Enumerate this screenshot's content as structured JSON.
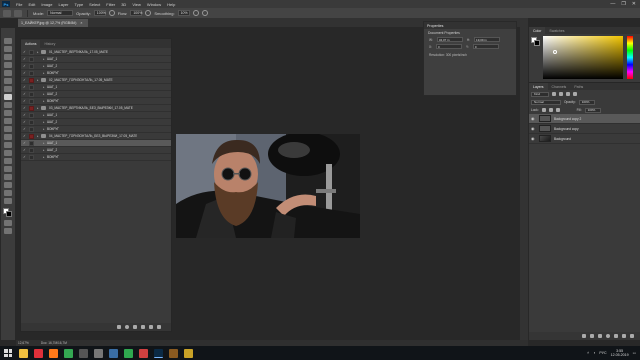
{
  "app": {
    "logo": "Ps"
  },
  "menu": [
    "File",
    "Edit",
    "Image",
    "Layer",
    "Type",
    "Select",
    "Filter",
    "3D",
    "View",
    "Window",
    "Help"
  ],
  "window_controls": [
    "—",
    "❐",
    "✕"
  ],
  "options_bar": {
    "mode_label": "Mode:",
    "mode_value": "Normal",
    "opacity_label": "Opacity:",
    "opacity_value": "100%",
    "flow_label": "Flow:",
    "flow_value": "100%",
    "smoothing_label": "Smoothing:",
    "smoothing_value": "10%"
  },
  "document_tab": {
    "title": "1_ЕАЙКЕР.jpg @ 12,7% (RGB/8#)",
    "close": "×"
  },
  "actions_panel": {
    "tabs": [
      "Actions",
      "History"
    ],
    "rows": [
      {
        "check": "✓",
        "dialog": "dark",
        "indent": 0,
        "folder": true,
        "name": "01_МАСТЕР_ВЕРТИКАЛЬ_17.05_МАТЕ",
        "selected": false
      },
      {
        "check": "✓",
        "dialog": "dark",
        "indent": 1,
        "folder": false,
        "name": "ШАГ_1",
        "selected": false
      },
      {
        "check": "✓",
        "dialog": "dark",
        "indent": 1,
        "folder": false,
        "name": "ШАГ_2",
        "selected": false
      },
      {
        "check": "✓",
        "dialog": "dark",
        "indent": 1,
        "folder": false,
        "name": "ВОКРУГ",
        "selected": false
      },
      {
        "check": "✓",
        "dialog": "red",
        "indent": 0,
        "folder": true,
        "name": "02_МАСТЕР_ГОРИЗОНТАЛЬ_17.05_МАТЕ",
        "selected": false
      },
      {
        "check": "✓",
        "dialog": "dark",
        "indent": 1,
        "folder": false,
        "name": "ШАГ_1",
        "selected": false
      },
      {
        "check": "✓",
        "dialog": "dark",
        "indent": 1,
        "folder": false,
        "name": "ШАГ_2",
        "selected": false
      },
      {
        "check": "✓",
        "dialog": "dark",
        "indent": 1,
        "folder": false,
        "name": "ВОКРУГ",
        "selected": false
      },
      {
        "check": "✓",
        "dialog": "red",
        "indent": 0,
        "folder": true,
        "name": "03_МАСТЕР_ВЕРТИКАЛЬ_БЕЗ_ВЫРЕЗКИ_17.05_МАТЕ",
        "selected": false
      },
      {
        "check": "✓",
        "dialog": "dark",
        "indent": 1,
        "folder": false,
        "name": "ШАГ_1",
        "selected": false
      },
      {
        "check": "✓",
        "dialog": "dark",
        "indent": 1,
        "folder": false,
        "name": "ШАГ_2",
        "selected": false
      },
      {
        "check": "✓",
        "dialog": "dark",
        "indent": 1,
        "folder": false,
        "name": "ВОКРУГ",
        "selected": false
      },
      {
        "check": "✓",
        "dialog": "red",
        "indent": 0,
        "folder": true,
        "name": "04_МАСТЕР_ГОРИЗОНТАЛЬ_БЕЗ_ВЫРЕЗКИ_17.05_МАТЕ",
        "selected": false
      },
      {
        "check": "✓",
        "dialog": "dark",
        "indent": 1,
        "folder": false,
        "name": "ШАГ_1",
        "selected": true
      },
      {
        "check": "✓",
        "dialog": "dark",
        "indent": 1,
        "folder": false,
        "name": "ШАГ_2",
        "selected": false
      },
      {
        "check": "✓",
        "dialog": "dark",
        "indent": 1,
        "folder": false,
        "name": "ВОКРУГ",
        "selected": false
      }
    ]
  },
  "properties_panel": {
    "title": "Properties",
    "subtitle": "Document Properties",
    "w_label": "W:",
    "w_value": "34,07 in",
    "h_label": "H:",
    "h_value": "19,09 in",
    "x_label": "X:",
    "x_value": "0",
    "y_label": "Y:",
    "y_value": "0",
    "resolution": "Resolution: 300 pixels/inch"
  },
  "color_panel": {
    "tabs": [
      "Color",
      "Swatches"
    ],
    "hue_color": "#f2c500"
  },
  "layers_panel": {
    "tabs": [
      "Layers",
      "Channels",
      "Paths"
    ],
    "kind_label": "Kind",
    "blend_mode": "Normal",
    "opacity_label": "Opacity:",
    "opacity_value": "100%",
    "lock_label": "Lock:",
    "fill_label": "Fill:",
    "fill_value": "100%",
    "layers": [
      {
        "name": "Background copy 2",
        "selected": true,
        "thumb": "plain"
      },
      {
        "name": "Background copy",
        "selected": false,
        "thumb": "plain"
      },
      {
        "name": "Background",
        "selected": false,
        "thumb": "img"
      }
    ]
  },
  "status_bar": {
    "zoom": "12,67%",
    "doc": "Doc: 16,7M/16,7M"
  },
  "taskbar": {
    "apps": [
      {
        "name": "explorer",
        "color": "#f0c040"
      },
      {
        "name": "opera",
        "color": "#e0303a"
      },
      {
        "name": "firefox",
        "color": "#ff7a1a"
      },
      {
        "name": "chrome",
        "color": "#34a853"
      },
      {
        "name": "media",
        "color": "#555555"
      },
      {
        "name": "app",
        "color": "#777777"
      },
      {
        "name": "video",
        "color": "#3a6ea5"
      },
      {
        "name": "camtasia",
        "color": "#2fa84f"
      },
      {
        "name": "utility",
        "color": "#d04040"
      },
      {
        "name": "photoshop",
        "color": "#0b2a45"
      },
      {
        "name": "bridge",
        "color": "#8a5a20"
      },
      {
        "name": "notes",
        "color": "#c9a227"
      }
    ],
    "lang": "РУС",
    "time": "3:55",
    "date": "12.05.2019"
  }
}
